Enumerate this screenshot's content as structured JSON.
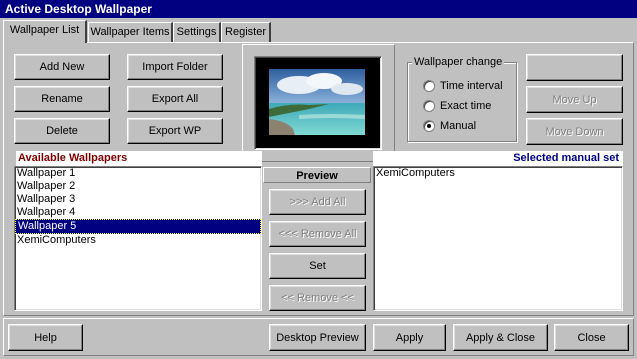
{
  "window": {
    "title": "Active Desktop Wallpaper"
  },
  "tabs": [
    {
      "label": "Wallpaper List",
      "active": true
    },
    {
      "label": "Wallpaper Items"
    },
    {
      "label": "Settings"
    },
    {
      "label": "Register"
    }
  ],
  "actions": {
    "add_new": "Add New",
    "import_folder": "Import Folder",
    "rename": "Rename",
    "export_all": "Export All",
    "delete": "Delete",
    "export_wp": "Export WP"
  },
  "wallpaper_change": {
    "title": "Wallpaper change",
    "options": [
      "Time interval",
      "Exact time",
      "Manual"
    ],
    "selected": "Manual"
  },
  "side_buttons": {
    "top": "",
    "move_up": "Move Up",
    "move_down": "Move Down"
  },
  "available": {
    "header": "Available Wallpapers",
    "items": [
      "Wallpaper 1",
      "Wallpaper 2",
      "Wallpaper 3",
      "Wallpaper 4",
      "Wallpaper 5",
      "XemiComputers"
    ],
    "selected_index": 4
  },
  "middle": {
    "preview_header": "Preview",
    "add_all": ">>>      Add All",
    "remove_all": "<<<   Remove All",
    "set": "Set",
    "remove": "<< Remove <<"
  },
  "selected_set": {
    "header": "Selected manual set",
    "items": [
      "XemiComputers"
    ]
  },
  "footer": {
    "help": "Help",
    "desktop_preview": "Desktop Preview",
    "apply": "Apply",
    "apply_close": "Apply & Close",
    "close": "Close"
  },
  "colors": {
    "titlebar": "#000080",
    "available_header": "#800000",
    "selected_header": "#000080"
  }
}
